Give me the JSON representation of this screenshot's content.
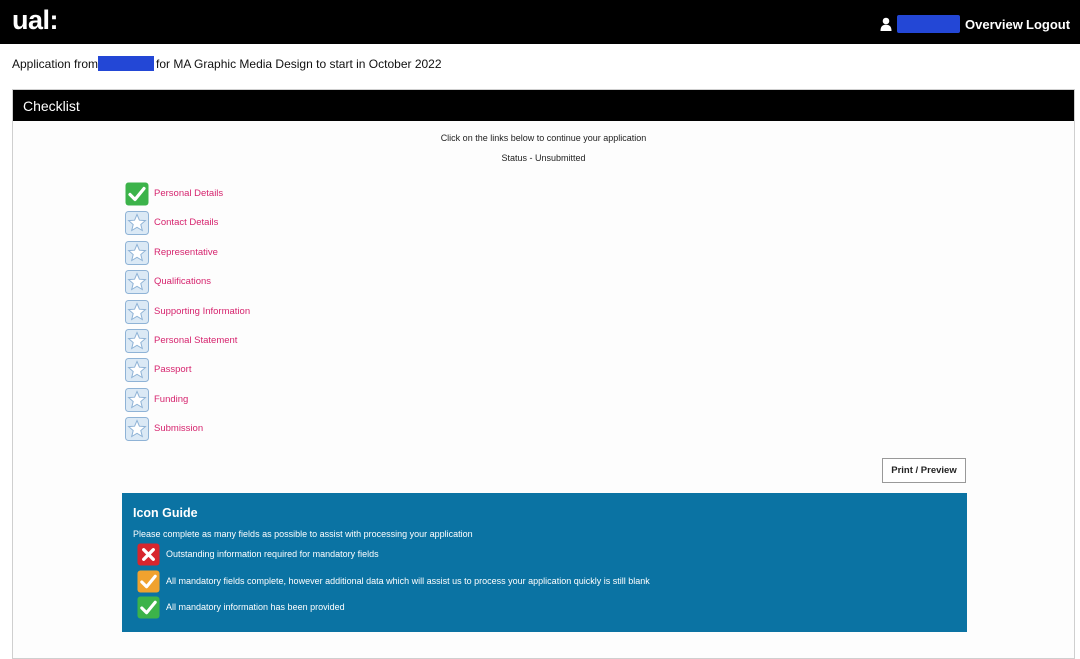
{
  "header": {
    "logo": "ual:",
    "user_icon": "user-icon",
    "nav": {
      "overview": "Overview",
      "logout": "Logout"
    }
  },
  "application": {
    "prefix": "Application from",
    "suffix": "for MA Graphic Media Design to start in October 2022"
  },
  "checklist": {
    "title": "Checklist",
    "instruction": "Click on the links below to continue your application",
    "status": "Status - Unsubmitted",
    "items": [
      {
        "label": "Personal Details",
        "icon": "check-icon"
      },
      {
        "label": "Contact Details",
        "icon": "star-icon"
      },
      {
        "label": "Representative",
        "icon": "star-icon"
      },
      {
        "label": "Qualifications",
        "icon": "star-icon"
      },
      {
        "label": "Supporting Information",
        "icon": "star-icon"
      },
      {
        "label": "Personal Statement",
        "icon": "star-icon"
      },
      {
        "label": "Passport",
        "icon": "star-icon"
      },
      {
        "label": "Funding",
        "icon": "star-icon"
      },
      {
        "label": "Submission",
        "icon": "star-icon"
      }
    ],
    "print_label": "Print / Preview"
  },
  "icon_guide": {
    "title": "Icon Guide",
    "subtitle": "Please complete as many fields as possible to assist with processing your application",
    "rows": [
      {
        "icon": "red-cross-icon",
        "text": "Outstanding information required for mandatory fields"
      },
      {
        "icon": "orange-check-icon",
        "text": "All mandatory fields complete, however additional data which will assist us to process your application quickly is still blank"
      },
      {
        "icon": "green-check-icon",
        "text": "All mandatory information has been provided"
      }
    ]
  },
  "colors": {
    "header_bg": "#000000",
    "link": "#d6246e",
    "guide_bg": "#0b73a3",
    "redaction": "#2347d6",
    "complete": "#3cb34a",
    "partial": "#f0a22e",
    "outstanding": "#d7262e"
  }
}
